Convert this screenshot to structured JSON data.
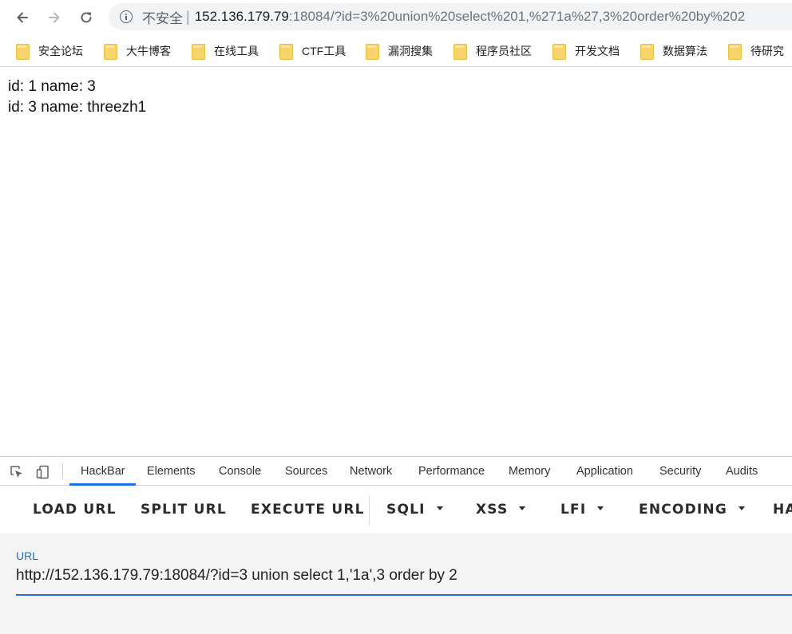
{
  "browser": {
    "security_label": "不安全",
    "separator": "|",
    "url_host": "152.136.179.79",
    "url_rest": ":18084/?id=3%20union%20select%201,%271a%27,3%20order%20by%202"
  },
  "bookmarks": [
    {
      "label": "安全论坛"
    },
    {
      "label": "大牛博客"
    },
    {
      "label": "在线工具"
    },
    {
      "label": "CTF工具"
    },
    {
      "label": "漏洞搜集"
    },
    {
      "label": "程序员社区"
    },
    {
      "label": "开发文档"
    },
    {
      "label": "数据算法"
    },
    {
      "label": "待研究"
    }
  ],
  "page": {
    "lines": [
      "id: 1 name: 3",
      "id: 3 name: threezh1"
    ]
  },
  "devtools": {
    "tabs": [
      {
        "label": "HackBar"
      },
      {
        "label": "Elements"
      },
      {
        "label": "Console"
      },
      {
        "label": "Sources"
      },
      {
        "label": "Network"
      },
      {
        "label": "Performance"
      },
      {
        "label": "Memory"
      },
      {
        "label": "Application"
      },
      {
        "label": "Security"
      },
      {
        "label": "Audits"
      }
    ],
    "active_tab": "HackBar"
  },
  "hackbar": {
    "buttons": [
      {
        "label": "LOAD URL"
      },
      {
        "label": "SPLIT URL"
      },
      {
        "label": "EXECUTE URL"
      },
      {
        "label": "SQLI"
      },
      {
        "label": "XSS"
      },
      {
        "label": "LFI"
      },
      {
        "label": "ENCODING"
      },
      {
        "label": "HA"
      }
    ],
    "url_label": "URL",
    "url_value": "http://152.136.179.79:18084/?id=3 union select 1,'1a',3 order by 2"
  },
  "colors": {
    "accent": "#1a73e8",
    "folder": "#f7d46b"
  }
}
